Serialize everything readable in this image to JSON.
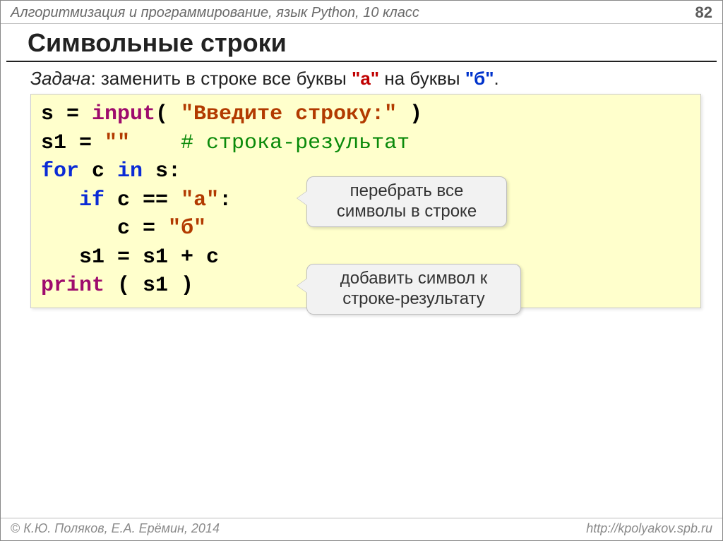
{
  "header": {
    "course": "Алгоритмизация и программирование, язык Python, 10 класс",
    "page": "82"
  },
  "title": "Символьные строки",
  "task": {
    "label": "Задача",
    "text_before": ": заменить в строке все буквы ",
    "a": "\"а\"",
    "mid": " на буквы ",
    "b": "\"б\"",
    "end": "."
  },
  "code": {
    "l1": {
      "p1": "s = ",
      "bi": "input",
      "p2": "( ",
      "str": "\"Введите строку:\"",
      "p3": " )"
    },
    "l2": {
      "p1": "s1 = ",
      "str": "\"\"",
      "sp": "    ",
      "cmt": "# строка-результат"
    },
    "l3": {
      "kw1": "for",
      "p1": " c ",
      "kw2": "in",
      "p2": " s:"
    },
    "l4": {
      "indent": "   ",
      "kw": "if",
      "p1": " c == ",
      "str": "\"а\"",
      "p2": ":"
    },
    "l5": {
      "indent": "      ",
      "p1": "c = ",
      "str": "\"б\""
    },
    "l6": {
      "indent": "   ",
      "p1": "s1 = s1 + c"
    },
    "l7": {
      "bi": "print",
      "p1": " ( s1 )"
    }
  },
  "callouts": {
    "c1": "перебрать все символы в строке",
    "c2": "добавить символ к строке-результату"
  },
  "footer": {
    "copyright": "К.Ю. Поляков, Е.А. Ерёмин, 2014",
    "url": "http://kpolyakov.spb.ru"
  }
}
